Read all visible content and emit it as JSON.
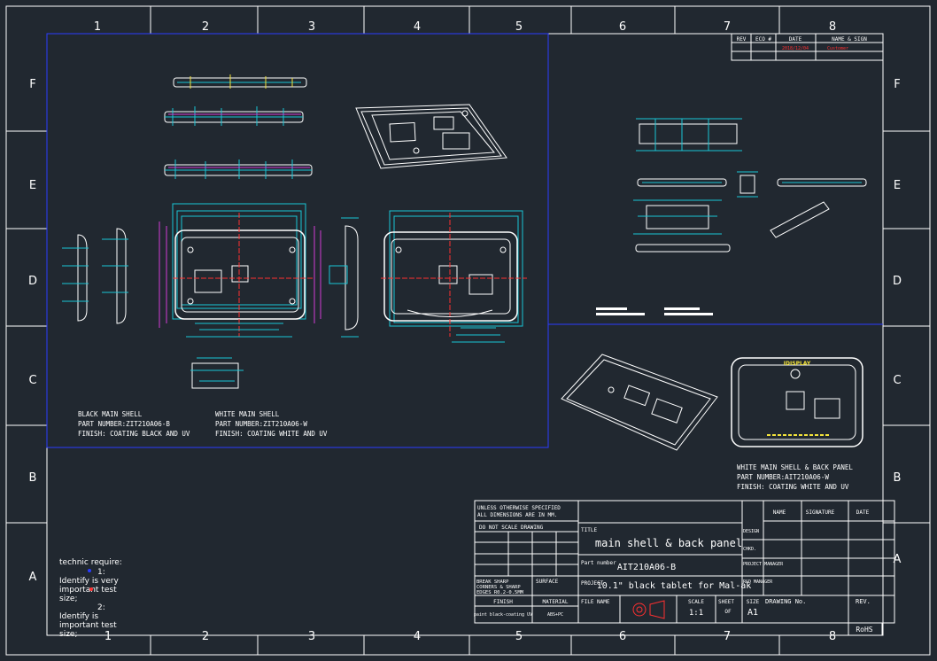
{
  "colors": {
    "background": "#212830",
    "linework": "#ffffff",
    "dimensions": "#19c6d6",
    "viewport": "#2a3cff",
    "detail": "#d43bd6",
    "centerline": "#ff3030",
    "highlight": "#f2e23a"
  },
  "grid": {
    "columns": [
      "1",
      "2",
      "3",
      "4",
      "5",
      "6",
      "7",
      "8"
    ],
    "rows": [
      "F",
      "E",
      "D",
      "C",
      "B",
      "A"
    ]
  },
  "revision_table": {
    "headers": [
      "REV",
      "ECO #",
      "DATE",
      "NAME & SIGN"
    ],
    "row": [
      "",
      "",
      "2018/12/04",
      "Customer"
    ]
  },
  "notes": {
    "black_shell": [
      "BLACK MAIN SHELL",
      "PART NUMBER:ZIT210A06-B",
      "FINISH: COATING BLACK AND UV"
    ],
    "white_shell": [
      "WHITE MAIN SHELL",
      "PART NUMBER:ZIT210A06-W",
      "FINISH: COATING WHITE AND UV"
    ],
    "white_back": [
      "WHITE MAIN SHELL & BACK PANEL",
      "PART NUMBER:AIT210A06-W",
      "FINISH: COATING WHITE AND UV"
    ],
    "brand_logo": "IDISPLAY"
  },
  "technic": {
    "title": "technic require:",
    "item1_num": "1:",
    "item1": [
      "Identify is very",
      "important test",
      "size;"
    ],
    "item2_num": "2:",
    "item2": [
      "Identify is",
      "important test",
      "size;"
    ]
  },
  "title_block": {
    "tolerance_note": [
      "UNLESS OTHERWISE SPECIFIED",
      "ALL DIMENSIONS ARE IN MM."
    ],
    "do_not_scale": "DO NOT SCALE DRAWING",
    "edges_note": [
      "BREAK SHARP",
      "CORNERS & SHARP",
      "EDGES R0.2-0.5MM"
    ],
    "surface_label": "SURFACE",
    "finish_label": "FINISH",
    "material_label": "MATERIAL",
    "finish_value": "paint black-coating UV",
    "material_value": "ABS+PC",
    "title_label": "TITLE",
    "title_value": "main shell & back panel",
    "part_label": "Part number",
    "part_value": "AIT210A06-B",
    "project_label": "PROJECT",
    "project_value": "10.1\" black tablet for Mal-ak",
    "file_label": "FILE NAME",
    "scale_label": "SCALE",
    "scale_value": "1:1",
    "sheet_label": "SHEET",
    "sheet_value": "OF",
    "size_label": "SIZE",
    "size_value": "A1",
    "drawing_no_label": "DRAWING No.",
    "rev_label": "REV.",
    "rohs": "RoHS",
    "sign_headers": [
      "NAME",
      "SIGNATURE",
      "DATE"
    ],
    "sign_rows": [
      "DESIGN",
      "CHKD.",
      "PROJECT MANAGER",
      "R&D MANAGER"
    ]
  }
}
